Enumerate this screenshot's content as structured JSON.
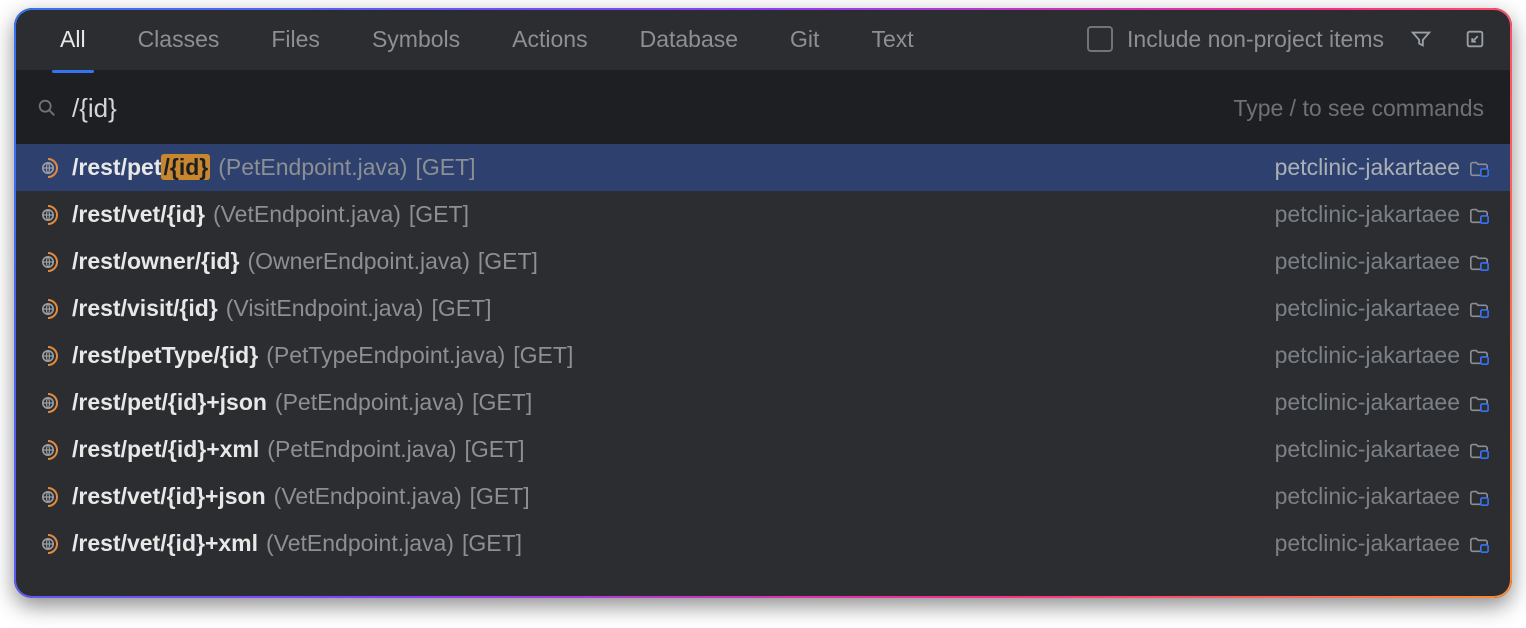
{
  "tabs": [
    "All",
    "Classes",
    "Files",
    "Symbols",
    "Actions",
    "Database",
    "Git",
    "Text"
  ],
  "active_tab": 0,
  "include_checkbox_label": "Include non-project items",
  "search_value": "/{id}",
  "search_hint": "Type / to see commands",
  "results": [
    {
      "prefix": "/rest/pet",
      "match": "/{id}",
      "suffix": "",
      "file": "(PetEndpoint.java)",
      "method": "[GET]",
      "module": "petclinic-jakartaee",
      "selected": true
    },
    {
      "prefix": "/rest/vet",
      "match": "/{id}",
      "suffix": "",
      "file": "(VetEndpoint.java)",
      "method": "[GET]",
      "module": "petclinic-jakartaee",
      "selected": false
    },
    {
      "prefix": "/rest/owner",
      "match": "/{id}",
      "suffix": "",
      "file": "(OwnerEndpoint.java)",
      "method": "[GET]",
      "module": "petclinic-jakartaee",
      "selected": false
    },
    {
      "prefix": "/rest/visit",
      "match": "/{id}",
      "suffix": "",
      "file": "(VisitEndpoint.java)",
      "method": "[GET]",
      "module": "petclinic-jakartaee",
      "selected": false
    },
    {
      "prefix": "/rest/petType",
      "match": "/{id}",
      "suffix": "",
      "file": "(PetTypeEndpoint.java)",
      "method": "[GET]",
      "module": "petclinic-jakartaee",
      "selected": false
    },
    {
      "prefix": "/rest/pet",
      "match": "/{id}",
      "suffix": "+json",
      "file": "(PetEndpoint.java)",
      "method": "[GET]",
      "module": "petclinic-jakartaee",
      "selected": false
    },
    {
      "prefix": "/rest/pet",
      "match": "/{id}",
      "suffix": "+xml",
      "file": "(PetEndpoint.java)",
      "method": "[GET]",
      "module": "petclinic-jakartaee",
      "selected": false
    },
    {
      "prefix": "/rest/vet",
      "match": "/{id}",
      "suffix": "+json",
      "file": "(VetEndpoint.java)",
      "method": "[GET]",
      "module": "petclinic-jakartaee",
      "selected": false
    },
    {
      "prefix": "/rest/vet",
      "match": "/{id}",
      "suffix": "+xml",
      "file": "(VetEndpoint.java)",
      "method": "[GET]",
      "module": "petclinic-jakartaee",
      "selected": false
    }
  ]
}
